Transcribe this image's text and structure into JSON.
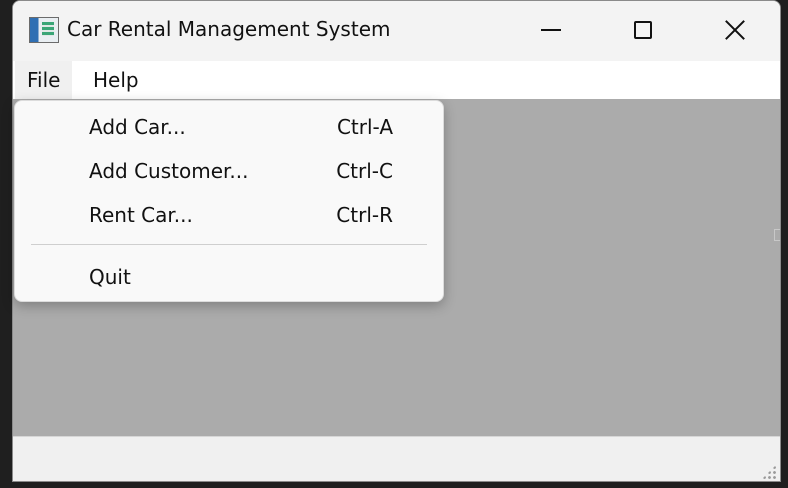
{
  "window": {
    "title": "Car Rental Management System",
    "icon": "app-window-icon",
    "controls": {
      "minimize_icon": "minimize-icon",
      "maximize_icon": "maximize-icon",
      "close_icon": "close-icon"
    }
  },
  "menubar": {
    "items": [
      {
        "label": "File",
        "active": true
      },
      {
        "label": "Help",
        "active": false
      }
    ]
  },
  "file_menu": {
    "items": [
      {
        "label": "Add Car...",
        "shortcut": "Ctrl-A"
      },
      {
        "label": "Add Customer...",
        "shortcut": "Ctrl-C"
      },
      {
        "label": "Rent Car...",
        "shortcut": "Ctrl-R"
      },
      {
        "label": "Quit",
        "shortcut": ""
      }
    ]
  },
  "colors": {
    "workspace": "#ababab",
    "menu_background": "#f9f9f9",
    "titlebar": "#f3f3f3"
  }
}
